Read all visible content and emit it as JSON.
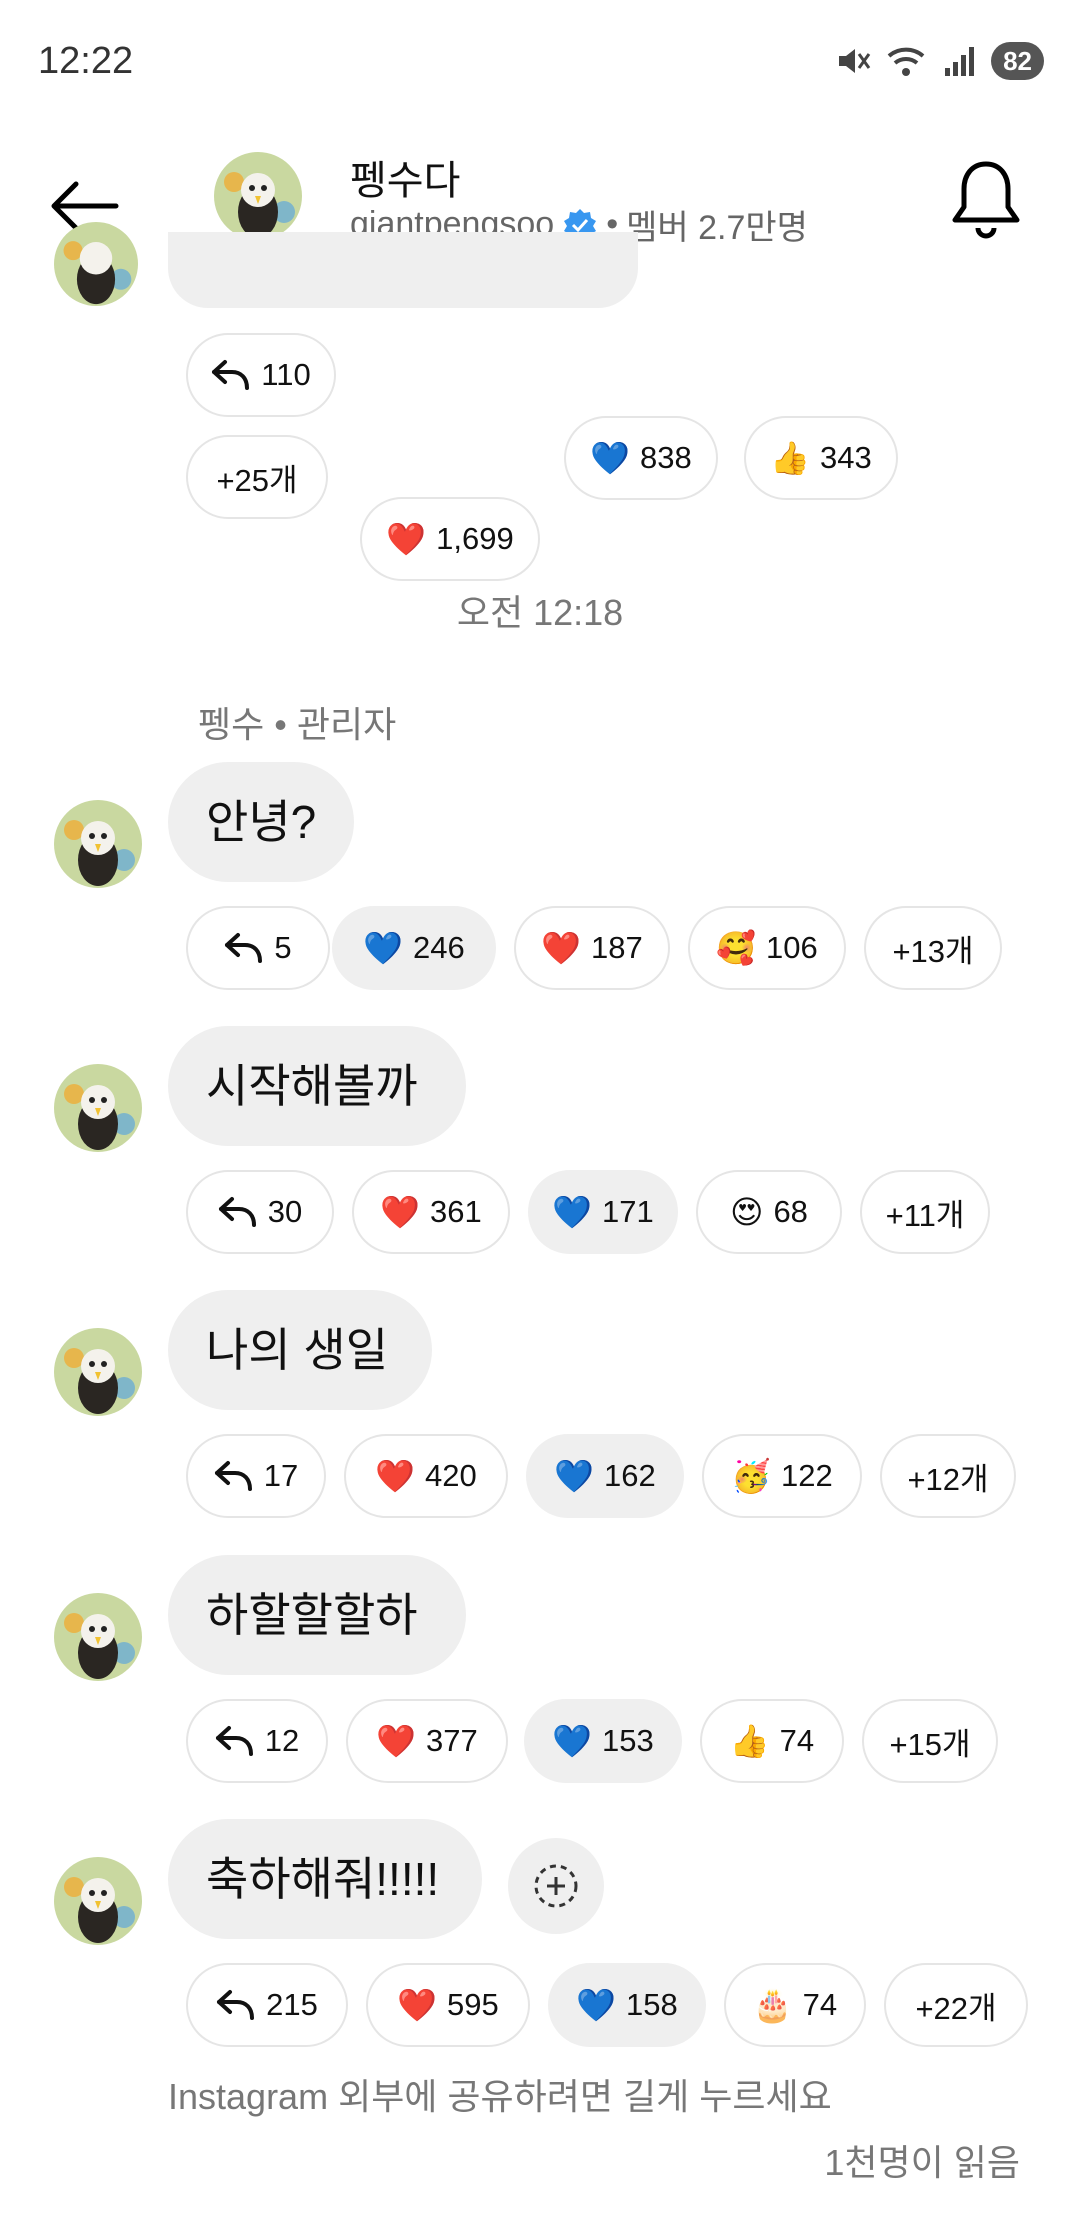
{
  "status_bar": {
    "time": "12:22",
    "battery": "82"
  },
  "header": {
    "title": "펭수다",
    "handle": "giantpengsoo",
    "separator": "•",
    "members": "멤버 2.7만명"
  },
  "first_message_reactions": [
    {
      "icon": "reply-icon",
      "count": "110"
    },
    {
      "icon": "red-heart-icon",
      "emoji": "❤️",
      "count": "1,699"
    },
    {
      "icon": "blue-heart-icon",
      "emoji": "💙",
      "count": "838"
    },
    {
      "icon": "thumbs-up-icon",
      "emoji": "👍",
      "count": "343"
    },
    {
      "label": "+25개"
    }
  ],
  "timestamp": "오전 12:18",
  "sender": "펭수 • 관리자",
  "messages": [
    {
      "text": "안녕?",
      "reactions": [
        {
          "icon": "reply-icon",
          "count": "5"
        },
        {
          "icon": "blue-heart-icon",
          "emoji": "💙",
          "count": "246",
          "selected": true
        },
        {
          "icon": "red-heart-icon",
          "emoji": "❤️",
          "count": "187"
        },
        {
          "icon": "smiling-hearts-icon",
          "emoji": "🥰",
          "count": "106"
        },
        {
          "label": "+13개"
        }
      ]
    },
    {
      "text": "시작해볼까",
      "reactions": [
        {
          "icon": "reply-icon",
          "count": "30"
        },
        {
          "icon": "red-heart-icon",
          "emoji": "❤️",
          "count": "361"
        },
        {
          "icon": "blue-heart-icon",
          "emoji": "💙",
          "count": "171",
          "selected": true
        },
        {
          "icon": "heart-eyes-icon",
          "emoji": "😍",
          "count": "68"
        },
        {
          "label": "+11개"
        }
      ]
    },
    {
      "text": "나의 생일",
      "reactions": [
        {
          "icon": "reply-icon",
          "count": "17"
        },
        {
          "icon": "red-heart-icon",
          "emoji": "❤️",
          "count": "420"
        },
        {
          "icon": "blue-heart-icon",
          "emoji": "💙",
          "count": "162",
          "selected": true
        },
        {
          "icon": "party-face-icon",
          "emoji": "🥳",
          "count": "122"
        },
        {
          "label": "+12개"
        }
      ]
    },
    {
      "text": "하할할할하",
      "reactions": [
        {
          "icon": "reply-icon",
          "count": "12"
        },
        {
          "icon": "red-heart-icon",
          "emoji": "❤️",
          "count": "377"
        },
        {
          "icon": "blue-heart-icon",
          "emoji": "💙",
          "count": "153",
          "selected": true
        },
        {
          "icon": "thumbs-up-icon",
          "emoji": "👍",
          "count": "74"
        },
        {
          "label": "+15개"
        }
      ]
    },
    {
      "text": "축하해줘!!!!!",
      "reactions": [
        {
          "icon": "reply-icon",
          "count": "215"
        },
        {
          "icon": "red-heart-icon",
          "emoji": "❤️",
          "count": "595"
        },
        {
          "icon": "blue-heart-icon",
          "emoji": "💙",
          "count": "158",
          "selected": true
        },
        {
          "icon": "birthday-cake-icon",
          "emoji": "🎂",
          "count": "74"
        },
        {
          "label": "+22개"
        }
      ]
    }
  ],
  "footer": {
    "share_hint": "Instagram 외부에 공유하려면 길게 누르세요",
    "read_count": "1천명이 읽음"
  }
}
